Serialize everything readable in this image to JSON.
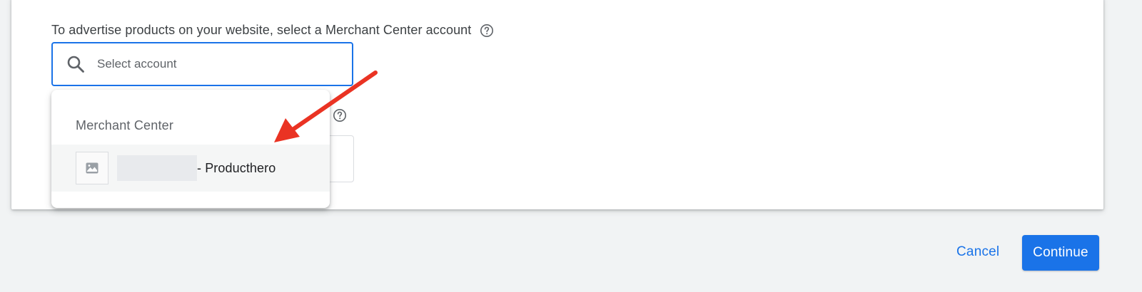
{
  "merchant_field": {
    "label": "To advertise products on your website, select a Merchant Center account",
    "help_icon": "help-circle-icon",
    "search_icon": "search-icon",
    "placeholder": "Select account"
  },
  "dropdown": {
    "heading": "Merchant Center",
    "items": [
      {
        "label": "- Producthero",
        "icon": "image-placeholder-icon",
        "name_redacted": true
      }
    ]
  },
  "annotation": {
    "arrow_color": "#ea3323"
  },
  "footer": {
    "cancel_label": "Cancel",
    "continue_label": "Continue"
  },
  "colors": {
    "accent": "#1a73e8",
    "background": "#f1f3f4",
    "card": "#ffffff"
  }
}
